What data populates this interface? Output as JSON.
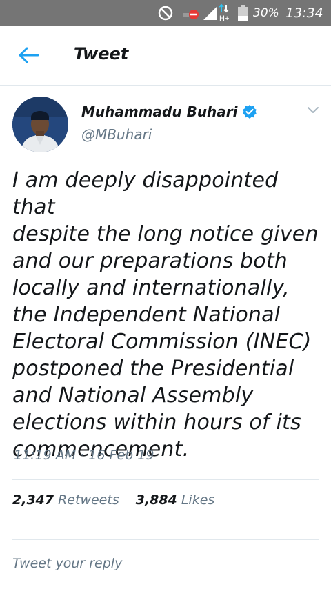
{
  "status_bar": {
    "battery": "30%",
    "time": "13:34",
    "network": "H+"
  },
  "header": {
    "title": "Tweet"
  },
  "tweet": {
    "author_name": "Muhammadu Buhari",
    "handle": "@MBuhari",
    "text_lines": [
      "I am deeply disappointed that",
      "despite the long notice given",
      "and our preparations both",
      "locally and internationally,",
      "the Independent National",
      "Electoral Commission (INEC)",
      "postponed the Presidential",
      "and National Assembly",
      "elections within hours of its",
      "commencement."
    ],
    "timestamp": "11:19 AM · 16 Feb 19",
    "retweets_count": "2,347",
    "retweets_label": "Retweets",
    "likes_count": "3,884",
    "likes_label": "Likes"
  },
  "reply": {
    "placeholder": "Tweet your reply"
  },
  "colors": {
    "accent": "#1da1f2",
    "status_bar_bg": "#757575",
    "secondary_text": "#657786"
  }
}
